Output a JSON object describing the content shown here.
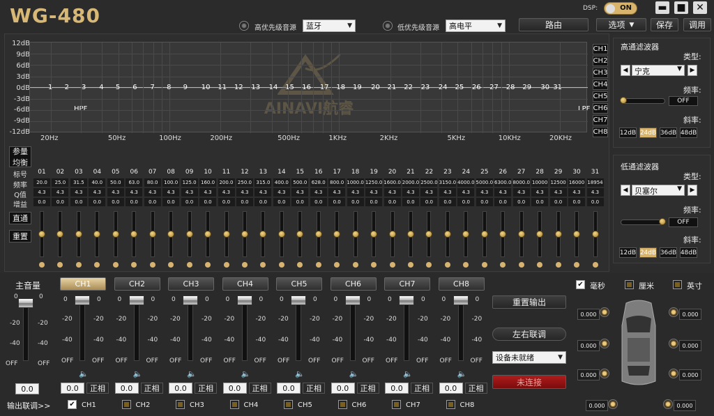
{
  "app": {
    "title": "WG-480"
  },
  "top": {
    "dsp_label": "DSP:",
    "dsp_toggle": "ON",
    "high_priority_label": "高优先级音源",
    "high_priority_value": "蓝牙",
    "low_priority_label": "低优先级音源",
    "low_priority_value": "高电平",
    "route_button": "路由",
    "options_button": "选项",
    "save_button": "保存",
    "load_button": "调用"
  },
  "eq": {
    "y_labels": [
      "12dB",
      "9dB",
      "6dB",
      "3dB",
      "0dB",
      "-3dB",
      "-6dB",
      "-9dB",
      "-12dB"
    ],
    "x_labels": [
      "20Hz",
      "50Hz",
      "100Hz",
      "200Hz",
      "500Hz",
      "1KHz",
      "2KHz",
      "5KHz",
      "10KHz",
      "20KHz"
    ],
    "hpf": "HPF",
    "lpf": "LPF",
    "logo": "AINAVI航睿",
    "channels": [
      "CH1",
      "CH2",
      "CH3",
      "CH4",
      "CH5",
      "CH6",
      "CH7",
      "CH8"
    ],
    "param_eq": "参量",
    "graphic_eq": "均衡",
    "row_labels": {
      "band": "标号",
      "freq": "频率",
      "q": "Q值",
      "gain": "增益"
    },
    "bands": [
      "01",
      "02",
      "03",
      "04",
      "05",
      "06",
      "07",
      "08",
      "09",
      "10",
      "11",
      "12",
      "13",
      "14",
      "15",
      "16",
      "17",
      "18",
      "19",
      "20",
      "21",
      "22",
      "23",
      "24",
      "25",
      "26",
      "27",
      "28",
      "29",
      "30",
      "31"
    ],
    "freqs": [
      "20.0",
      "25.0",
      "31.5",
      "40.0",
      "50.0",
      "63.0",
      "80.0",
      "100.0",
      "125.0",
      "160.0",
      "200.0",
      "250.0",
      "315.0",
      "400.0",
      "500.0",
      "628.0",
      "800.0",
      "1000.0",
      "1250.0",
      "1600.0",
      "2000.0",
      "2500.0",
      "3150.0",
      "4000.0",
      "5000.0",
      "6300.0",
      "8000.0",
      "10000",
      "12500",
      "16000",
      "18954"
    ],
    "q_value": "4.3",
    "gain_value": "0.0",
    "bypass": "直通",
    "reset": "重置"
  },
  "hp_filter": {
    "title": "高通滤波器",
    "type_label": "类型:",
    "type_value": "宁克",
    "freq_label": "频率:",
    "freq_value": "OFF",
    "slope_label": "斜率:",
    "slopes": [
      "12dB",
      "24dB",
      "36dB",
      "48dB"
    ],
    "active_slope": "24dB"
  },
  "lp_filter": {
    "title": "低通滤波器",
    "type_label": "类型:",
    "type_value": "贝塞尔",
    "freq_label": "频率:",
    "freq_value": "OFF",
    "slope_label": "斜率:",
    "slopes": [
      "12dB",
      "24dB",
      "36dB",
      "48dB"
    ],
    "active_slope": "24dB"
  },
  "master": {
    "label": "主音量",
    "top": "0",
    "mid1": "-20",
    "mid2": "-40",
    "bottom": "OFF",
    "value": "0.0"
  },
  "channels": [
    {
      "name": "CH1",
      "value": "0.0",
      "phase": "正相",
      "link_label": "CH1",
      "link": true
    },
    {
      "name": "CH2",
      "value": "0.0",
      "phase": "正相",
      "link_label": "CH2",
      "link": false
    },
    {
      "name": "CH3",
      "value": "0.0",
      "phase": "正相",
      "link_label": "CH3",
      "link": false
    },
    {
      "name": "CH4",
      "value": "0.0",
      "phase": "正相",
      "link_label": "CH4",
      "link": false
    },
    {
      "name": "CH5",
      "value": "0.0",
      "phase": "正相",
      "link_label": "CH5",
      "link": false
    },
    {
      "name": "CH6",
      "value": "0.0",
      "phase": "正相",
      "link_label": "CH6",
      "link": false
    },
    {
      "name": "CH7",
      "value": "0.0",
      "phase": "正相",
      "link_label": "CH7",
      "link": false
    },
    {
      "name": "CH8",
      "value": "0.0",
      "phase": "正相",
      "link_label": "CH8",
      "link": false
    }
  ],
  "fader_scale": {
    "top": "0",
    "mid1": "-20",
    "mid2": "-40",
    "bottom": "OFF"
  },
  "output_link_label": "输出联调>>",
  "actions": {
    "reset_output": "重置输出",
    "lr_link": "左右联调",
    "device_select": "设备未就绪",
    "connect": "未连接"
  },
  "delay": {
    "units": [
      {
        "label": "毫秒",
        "checked": true
      },
      {
        "label": "厘米",
        "checked": false
      },
      {
        "label": "英寸",
        "checked": false
      }
    ],
    "values": [
      "0.000",
      "0.000",
      "0.000",
      "0.000",
      "0.000",
      "0.000",
      "0.000",
      "0.000"
    ]
  }
}
